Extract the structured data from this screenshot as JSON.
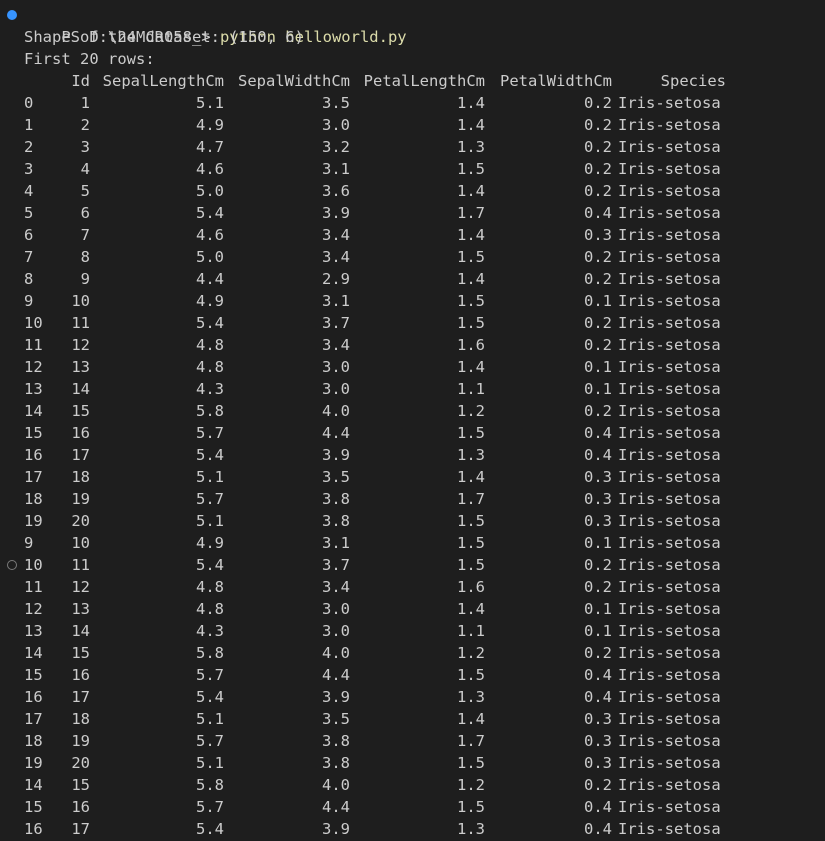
{
  "terminal": {
    "prompt": "PS D:\\24MCR058_> ",
    "command": "python helloworld.py",
    "shape_line": "Shape of the dataset: (150, 6)",
    "first_rows_line": "First 20 rows:",
    "headers": {
      "id": "Id",
      "sepal_length": "SepalLengthCm",
      "sepal_width": "SepalWidthCm",
      "petal_length": "PetalLengthCm",
      "petal_width": "PetalWidthCm",
      "species": "Species"
    },
    "rows_a": [
      {
        "idx": "0",
        "id": "1",
        "sl": "5.1",
        "sw": "3.5",
        "pl": "1.4",
        "pw": "0.2",
        "sp": "Iris-setosa"
      },
      {
        "idx": "1",
        "id": "2",
        "sl": "4.9",
        "sw": "3.0",
        "pl": "1.4",
        "pw": "0.2",
        "sp": "Iris-setosa"
      },
      {
        "idx": "2",
        "id": "3",
        "sl": "4.7",
        "sw": "3.2",
        "pl": "1.3",
        "pw": "0.2",
        "sp": "Iris-setosa"
      },
      {
        "idx": "3",
        "id": "4",
        "sl": "4.6",
        "sw": "3.1",
        "pl": "1.5",
        "pw": "0.2",
        "sp": "Iris-setosa"
      },
      {
        "idx": "4",
        "id": "5",
        "sl": "5.0",
        "sw": "3.6",
        "pl": "1.4",
        "pw": "0.2",
        "sp": "Iris-setosa"
      },
      {
        "idx": "5",
        "id": "6",
        "sl": "5.4",
        "sw": "3.9",
        "pl": "1.7",
        "pw": "0.4",
        "sp": "Iris-setosa"
      },
      {
        "idx": "6",
        "id": "7",
        "sl": "4.6",
        "sw": "3.4",
        "pl": "1.4",
        "pw": "0.3",
        "sp": "Iris-setosa"
      },
      {
        "idx": "7",
        "id": "8",
        "sl": "5.0",
        "sw": "3.4",
        "pl": "1.5",
        "pw": "0.2",
        "sp": "Iris-setosa"
      },
      {
        "idx": "8",
        "id": "9",
        "sl": "4.4",
        "sw": "2.9",
        "pl": "1.4",
        "pw": "0.2",
        "sp": "Iris-setosa"
      },
      {
        "idx": "9",
        "id": "10",
        "sl": "4.9",
        "sw": "3.1",
        "pl": "1.5",
        "pw": "0.1",
        "sp": "Iris-setosa"
      },
      {
        "idx": "10",
        "id": "11",
        "sl": "5.4",
        "sw": "3.7",
        "pl": "1.5",
        "pw": "0.2",
        "sp": "Iris-setosa"
      },
      {
        "idx": "11",
        "id": "12",
        "sl": "4.8",
        "sw": "3.4",
        "pl": "1.6",
        "pw": "0.2",
        "sp": "Iris-setosa"
      },
      {
        "idx": "12",
        "id": "13",
        "sl": "4.8",
        "sw": "3.0",
        "pl": "1.4",
        "pw": "0.1",
        "sp": "Iris-setosa"
      },
      {
        "idx": "13",
        "id": "14",
        "sl": "4.3",
        "sw": "3.0",
        "pl": "1.1",
        "pw": "0.1",
        "sp": "Iris-setosa"
      },
      {
        "idx": "14",
        "id": "15",
        "sl": "5.8",
        "sw": "4.0",
        "pl": "1.2",
        "pw": "0.2",
        "sp": "Iris-setosa"
      },
      {
        "idx": "15",
        "id": "16",
        "sl": "5.7",
        "sw": "4.4",
        "pl": "1.5",
        "pw": "0.4",
        "sp": "Iris-setosa"
      },
      {
        "idx": "16",
        "id": "17",
        "sl": "5.4",
        "sw": "3.9",
        "pl": "1.3",
        "pw": "0.4",
        "sp": "Iris-setosa"
      },
      {
        "idx": "17",
        "id": "18",
        "sl": "5.1",
        "sw": "3.5",
        "pl": "1.4",
        "pw": "0.3",
        "sp": "Iris-setosa"
      },
      {
        "idx": "18",
        "id": "19",
        "sl": "5.7",
        "sw": "3.8",
        "pl": "1.7",
        "pw": "0.3",
        "sp": "Iris-setosa"
      },
      {
        "idx": "19",
        "id": "20",
        "sl": "5.1",
        "sw": "3.8",
        "pl": "1.5",
        "pw": "0.3",
        "sp": "Iris-setosa"
      },
      {
        "idx": "9",
        "id": "10",
        "sl": "4.9",
        "sw": "3.1",
        "pl": "1.5",
        "pw": "0.1",
        "sp": "Iris-setosa"
      }
    ],
    "rows_b": [
      {
        "idx": "10",
        "id": "11",
        "sl": "5.4",
        "sw": "3.7",
        "pl": "1.5",
        "pw": "0.2",
        "sp": "Iris-setosa"
      },
      {
        "idx": "11",
        "id": "12",
        "sl": "4.8",
        "sw": "3.4",
        "pl": "1.6",
        "pw": "0.2",
        "sp": "Iris-setosa"
      },
      {
        "idx": "12",
        "id": "13",
        "sl": "4.8",
        "sw": "3.0",
        "pl": "1.4",
        "pw": "0.1",
        "sp": "Iris-setosa"
      },
      {
        "idx": "13",
        "id": "14",
        "sl": "4.3",
        "sw": "3.0",
        "pl": "1.1",
        "pw": "0.1",
        "sp": "Iris-setosa"
      },
      {
        "idx": "14",
        "id": "15",
        "sl": "5.8",
        "sw": "4.0",
        "pl": "1.2",
        "pw": "0.2",
        "sp": "Iris-setosa"
      },
      {
        "idx": "15",
        "id": "16",
        "sl": "5.7",
        "sw": "4.4",
        "pl": "1.5",
        "pw": "0.4",
        "sp": "Iris-setosa"
      },
      {
        "idx": "16",
        "id": "17",
        "sl": "5.4",
        "sw": "3.9",
        "pl": "1.3",
        "pw": "0.4",
        "sp": "Iris-setosa"
      },
      {
        "idx": "17",
        "id": "18",
        "sl": "5.1",
        "sw": "3.5",
        "pl": "1.4",
        "pw": "0.3",
        "sp": "Iris-setosa"
      },
      {
        "idx": "18",
        "id": "19",
        "sl": "5.7",
        "sw": "3.8",
        "pl": "1.7",
        "pw": "0.3",
        "sp": "Iris-setosa"
      },
      {
        "idx": "19",
        "id": "20",
        "sl": "5.1",
        "sw": "3.8",
        "pl": "1.5",
        "pw": "0.3",
        "sp": "Iris-setosa"
      },
      {
        "idx": "14",
        "id": "15",
        "sl": "5.8",
        "sw": "4.0",
        "pl": "1.2",
        "pw": "0.2",
        "sp": "Iris-setosa"
      },
      {
        "idx": "15",
        "id": "16",
        "sl": "5.7",
        "sw": "4.4",
        "pl": "1.5",
        "pw": "0.4",
        "sp": "Iris-setosa"
      },
      {
        "idx": "16",
        "id": "17",
        "sl": "5.4",
        "sw": "3.9",
        "pl": "1.3",
        "pw": "0.4",
        "sp": "Iris-setosa"
      }
    ],
    "colors": {
      "background": "#1e1e1e",
      "text": "#cccccc",
      "command": "#dcdcaa",
      "decoration_success": "#3794ff",
      "decoration_default": "#7a7a7a"
    },
    "decorations": {
      "first": "command-success-dot-icon",
      "second": "command-default-circle-icon"
    }
  }
}
